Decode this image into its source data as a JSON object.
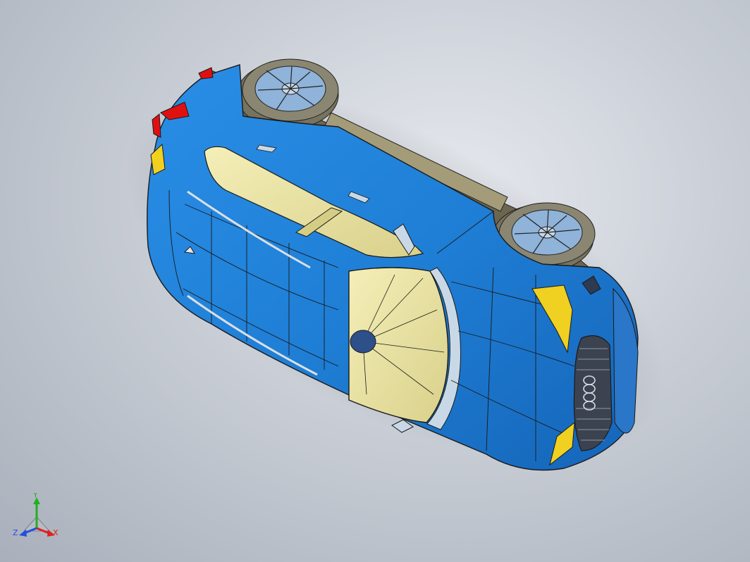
{
  "viewport": {
    "background_top": "#e6e9ee",
    "background_bottom": "#a9b0bb"
  },
  "model": {
    "body_color": "#1f7fd6",
    "glass_color": "#efeaa6",
    "tire_color": "#8a8672",
    "rim_color": "#8fb3d9",
    "light_color": "#f0d020",
    "tail_light_color": "#e01010",
    "edge_color": "#1a1a1a"
  },
  "triad": {
    "x_label": "X",
    "y_label": "Y",
    "z_label": "Z",
    "x_color": "#e02020",
    "y_color": "#20b020",
    "z_color": "#2050e0"
  }
}
